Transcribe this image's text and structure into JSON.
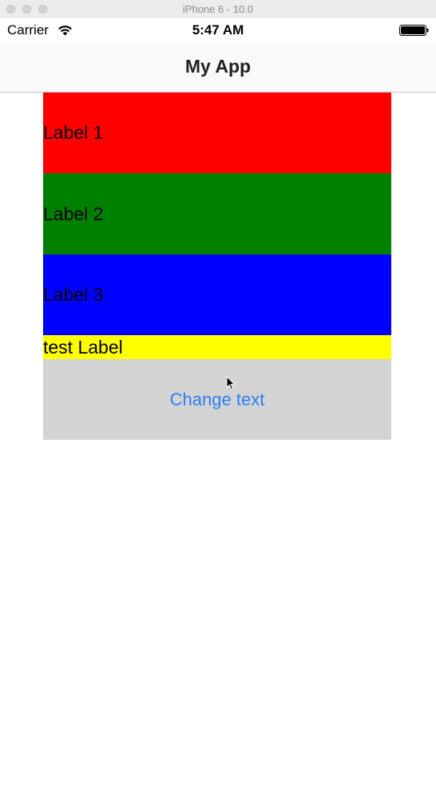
{
  "simulator": {
    "title": "iPhone 6 - 10.0"
  },
  "status_bar": {
    "carrier": "Carrier",
    "time": "5:47 AM"
  },
  "nav": {
    "title": "My App"
  },
  "labels": [
    {
      "text": "Label 1",
      "color": "#ff0000"
    },
    {
      "text": "Label 2",
      "color": "#008000"
    },
    {
      "text": "Label 3",
      "color": "#0000ff"
    },
    {
      "text": "test Label",
      "color": "#ffff00"
    }
  ],
  "action": {
    "label": "Change text",
    "text_color": "#2e7ef6",
    "background": "#d3d3d3"
  },
  "icons": {
    "wifi": "wifi-icon",
    "battery": "battery-icon",
    "cursor": "cursor-icon"
  }
}
